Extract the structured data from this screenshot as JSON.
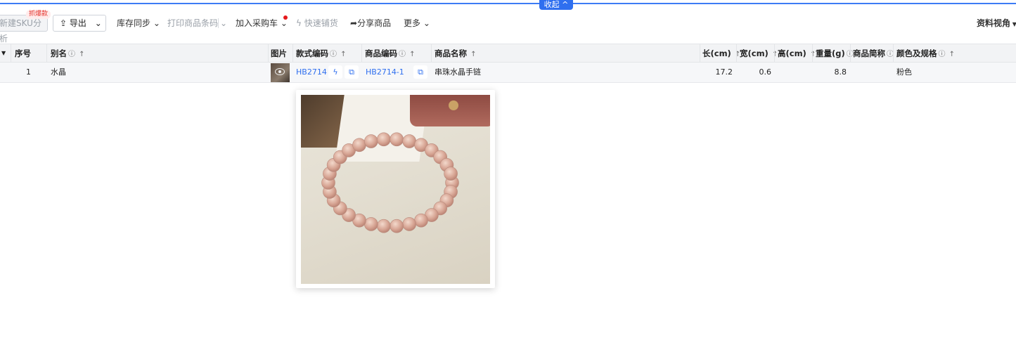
{
  "collapse": {
    "label": "收起 ^"
  },
  "toolbar": {
    "new_sku": "新建SKU分析",
    "badge": "抓爆款",
    "export": "导出",
    "inventory_sync": "库存同步",
    "print_barcode": "打印商品条码",
    "add_to_cart": "加入采购车",
    "quick_stock": "快速铺货",
    "share": "分享商品",
    "more": "更多",
    "view": "资料视角"
  },
  "table": {
    "headers": {
      "index": "序号",
      "alias": "别名",
      "image": "图片",
      "style_code": "款式编码",
      "product_code": "商品编码",
      "product_name": "商品名称",
      "length": "长(cm)",
      "width": "宽(cm)",
      "height": "高(cm)",
      "weight": "重量(g)",
      "short_name": "商品简称",
      "color_spec": "颜色及规格"
    },
    "rows": [
      {
        "index": "1",
        "alias": "水晶",
        "style_code": "HB2714",
        "product_code": "HB2714-1",
        "product_name": "串珠水晶手链",
        "length": "17.2",
        "width": "0.6",
        "height": "",
        "weight": "8.8",
        "short_name": "",
        "color_spec": "粉色"
      }
    ]
  },
  "colors": {
    "accent": "#2f6fef",
    "badge": "#e5352e",
    "header_bg": "#f2f3f5"
  },
  "icons": [
    "upload-icon",
    "chevron-down-icon",
    "lightning-icon",
    "share-icon",
    "info-icon",
    "sort-arrow-icon",
    "copy-icon",
    "eye-icon"
  ]
}
